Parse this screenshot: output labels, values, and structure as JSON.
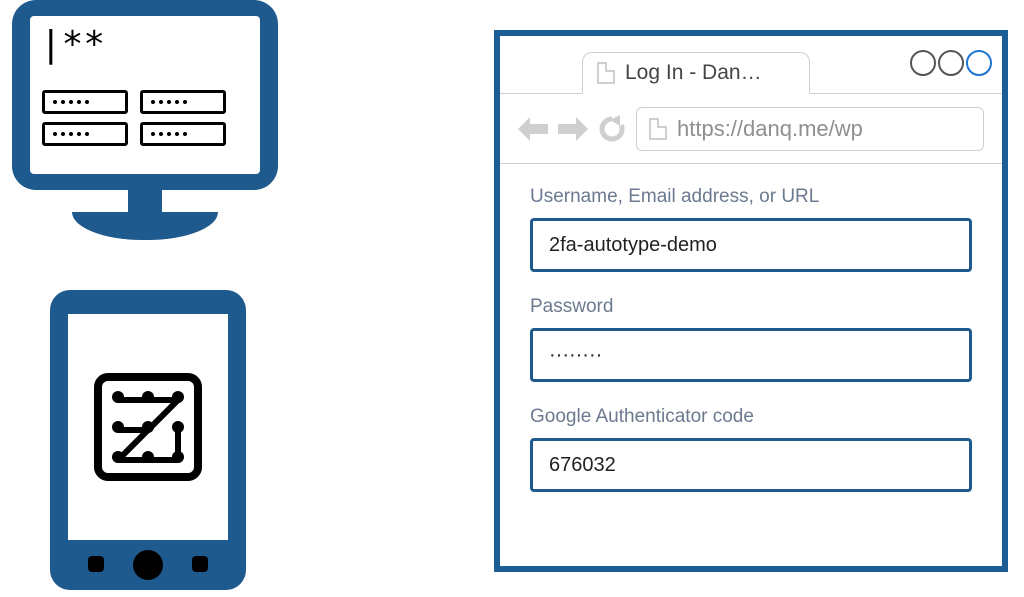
{
  "monitor": {
    "password_mask": "|**"
  },
  "browser": {
    "tab_title": "Log In - Dan…",
    "url": "https://danq.me/wp"
  },
  "form": {
    "username_label": "Username, Email address, or URL",
    "username_value": "2fa-autotype-demo",
    "password_label": "Password",
    "password_value": "········",
    "otp_label": "Google Authenticator code",
    "otp_value": "676032"
  },
  "colors": {
    "brand": "#1E5A8E"
  }
}
